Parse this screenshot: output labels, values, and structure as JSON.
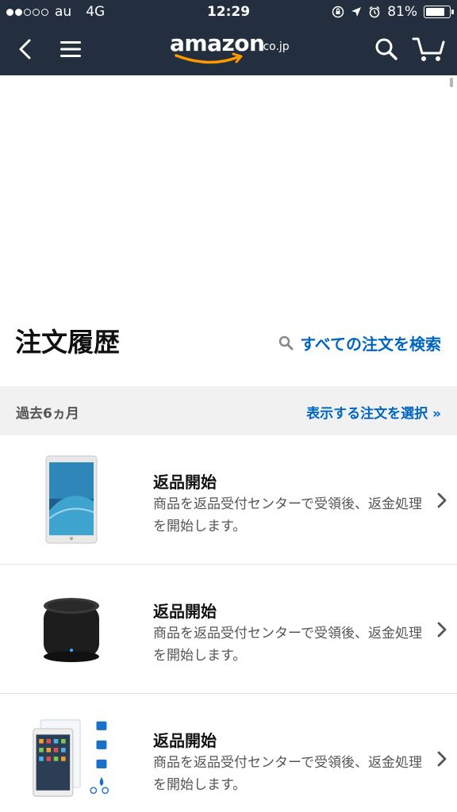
{
  "status_bar": {
    "carrier": "au",
    "network": "4G",
    "time": "12:29",
    "battery": "81%",
    "battery_level": 0.81,
    "signal_bars": 2
  },
  "navbar": {
    "logo_text": "amazon",
    "logo_suffix": ".co.jp",
    "background": "#232f3e",
    "logo_smile_color": "#ff9900"
  },
  "header": {
    "title": "注文履歴",
    "search_label": "すべての注文を検索"
  },
  "filter": {
    "period": "過去6ヵ月",
    "select_label": "表示する注文を選択 »"
  },
  "orders": [
    {
      "status": "返品開始",
      "description": "商品を返品受付センターで受領後、返金処理を開始します。",
      "thumbnail": "tablet-silver"
    },
    {
      "status": "返品開始",
      "description": "商品を返品受付センターで受領後、返金処理を開始します。",
      "thumbnail": "bluetooth-speaker"
    },
    {
      "status": "返品開始",
      "description": "商品を返品受付センターで受領後、返金処理を開始します。",
      "thumbnail": "tablet-screen-protector"
    }
  ],
  "colors": {
    "link": "#0066c0",
    "band": "#f1f1f1"
  },
  "icons": {
    "back": "back-chevron-icon",
    "menu": "hamburger-menu-icon",
    "search": "search-icon",
    "cart": "cart-icon",
    "row": "chevron-right-icon"
  }
}
